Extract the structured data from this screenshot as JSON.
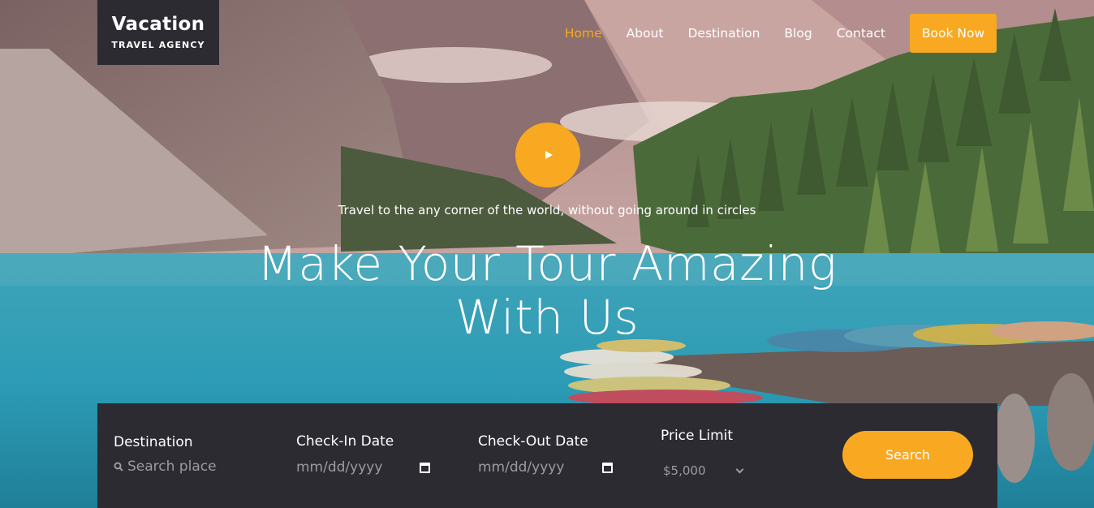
{
  "logo": {
    "title": "Vacation",
    "subtitle": "TRAVEL AGENCY"
  },
  "nav": {
    "items": [
      {
        "label": "Home",
        "active": true
      },
      {
        "label": "About"
      },
      {
        "label": "Destination"
      },
      {
        "label": "Blog"
      },
      {
        "label": "Contact"
      }
    ],
    "cta": "Book Now"
  },
  "hero": {
    "play_icon": "play-icon",
    "tagline": "Travel to the any corner of the world, without going around in circles",
    "headline_line1": "Make Your Tour Amazing",
    "headline_line2": "With Us"
  },
  "search": {
    "destination": {
      "label": "Destination",
      "placeholder": "Search place",
      "icon": "search-icon"
    },
    "checkin": {
      "label": "Check-In Date",
      "value": "mm/dd/yyyy",
      "icon": "calendar-icon"
    },
    "checkout": {
      "label": "Check-Out Date",
      "value": "mm/dd/yyyy",
      "icon": "calendar-icon"
    },
    "price": {
      "label": "Price Limit",
      "value": "$5,000",
      "icon": "chevron-down-icon"
    },
    "button": "Search"
  },
  "colors": {
    "accent": "#f8a921",
    "panel": "#2d2b32",
    "water": "#2aa3b8"
  }
}
